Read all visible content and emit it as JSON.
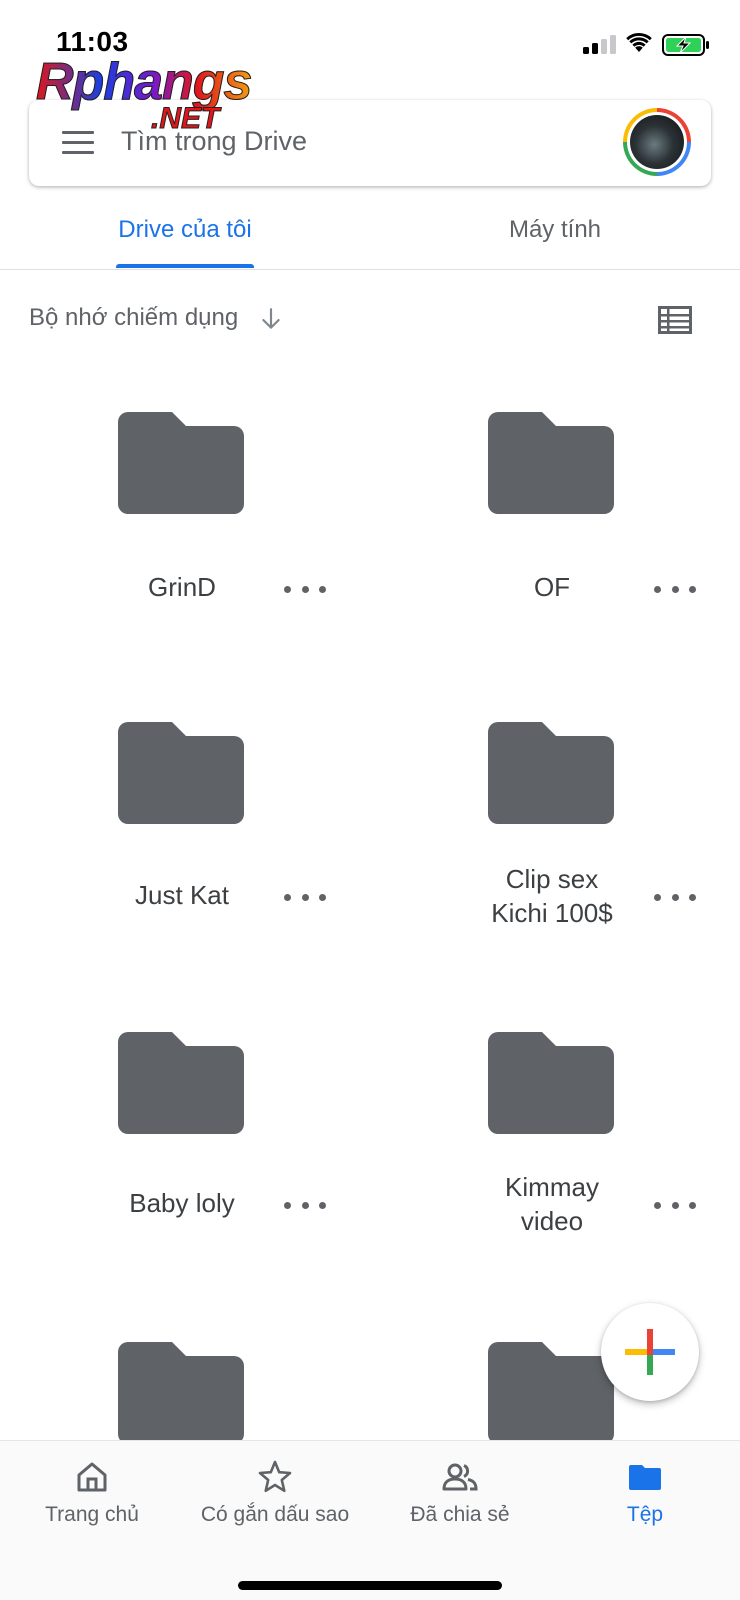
{
  "status_bar": {
    "time": "11:03"
  },
  "watermark": {
    "main": "Rphangs",
    "sub": ".NET"
  },
  "search": {
    "placeholder": "Tìm trong Drive"
  },
  "tabs": [
    {
      "label": "Drive của tôi",
      "active": true
    },
    {
      "label": "Máy tính",
      "active": false
    }
  ],
  "sort": {
    "label": "Bộ nhớ chiếm dụng"
  },
  "folders": [
    {
      "name": "GrinD"
    },
    {
      "name": "OF"
    },
    {
      "name": "Just Kat"
    },
    {
      "name": "Clip sex\nKichi 100$"
    },
    {
      "name": "Baby loly"
    },
    {
      "name": "Kimmay\nvideo"
    },
    {
      "name": ""
    },
    {
      "name": ""
    }
  ],
  "bottom_nav": [
    {
      "label": "Trang chủ",
      "icon": "home-icon",
      "active": false
    },
    {
      "label": "Có gắn dấu sao",
      "icon": "star-icon",
      "active": false
    },
    {
      "label": "Đã chia sẻ",
      "icon": "people-icon",
      "active": false
    },
    {
      "label": "Tệp",
      "icon": "folder-icon",
      "active": true
    }
  ],
  "colors": {
    "accent": "#1a73e8",
    "folder": "#5f6368",
    "text": "#3c4043",
    "fab_red": "#ea4335",
    "fab_blue": "#4285f4",
    "fab_green": "#34a853",
    "fab_yellow": "#fbbc04"
  }
}
